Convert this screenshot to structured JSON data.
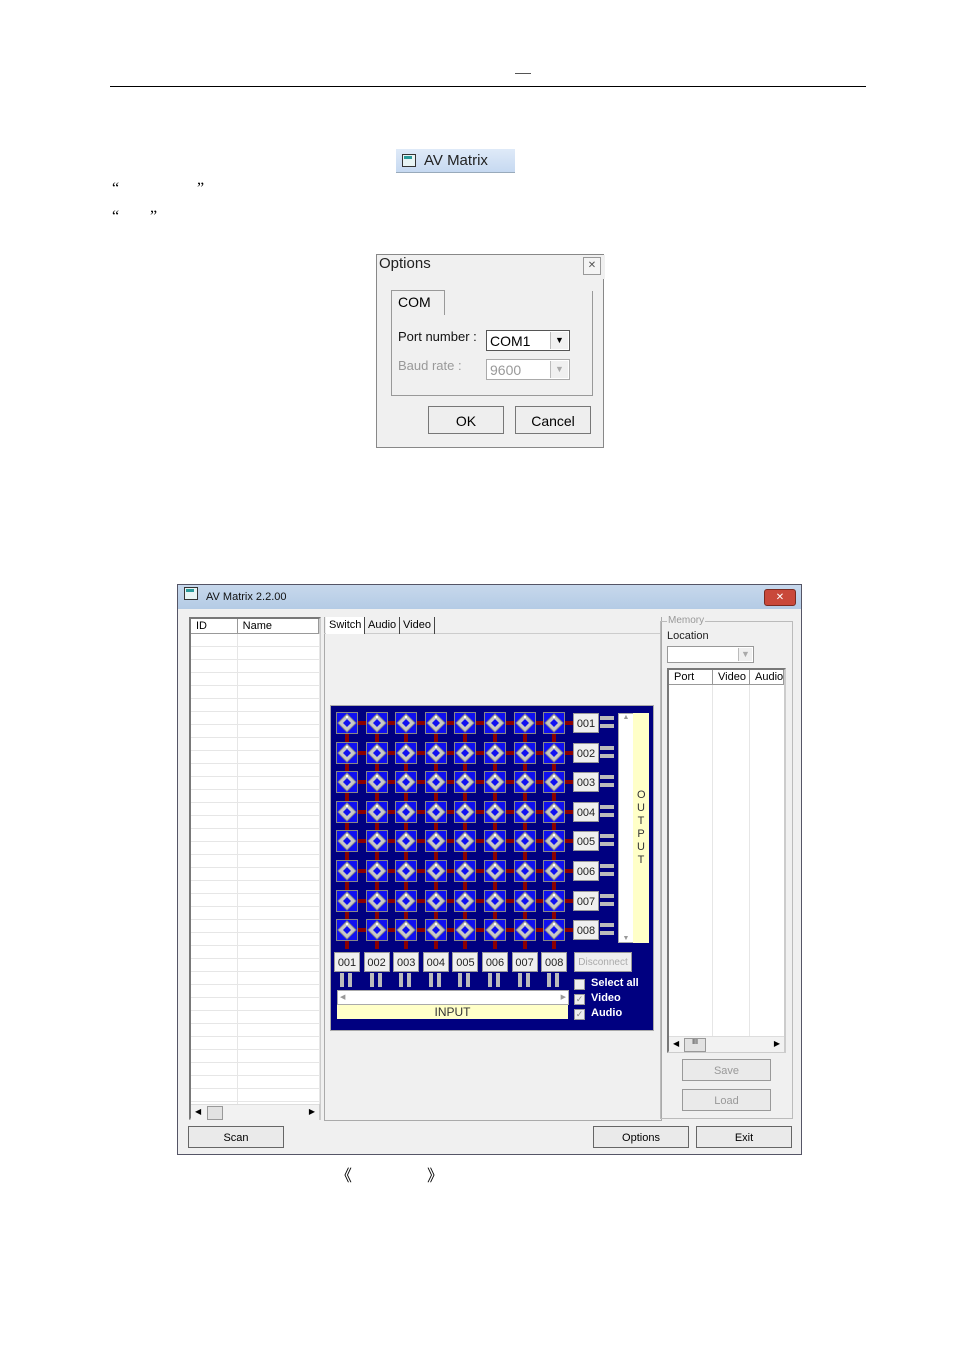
{
  "document": {
    "header_mark": "—",
    "quote_lines": [
      {
        "open": "“",
        "close": "”"
      },
      {
        "open": "“",
        "close": "”"
      }
    ],
    "caption_brackets": {
      "open": "《",
      "close": "》"
    }
  },
  "taskbar_button": {
    "label": "AV Matrix",
    "icon": "app-window-icon"
  },
  "options_dialog": {
    "title": "Options",
    "close_icon": "close-icon",
    "tab": "COM",
    "port_label": "Port number :",
    "port_value": "COM1",
    "baud_label": "Baud rate :",
    "baud_value": "9600",
    "ok_label": "OK",
    "cancel_label": "Cancel"
  },
  "app_window": {
    "title": "AV Matrix 2.2.00",
    "device_list": {
      "columns": [
        "ID",
        "Name"
      ],
      "rows": []
    },
    "tabs": [
      {
        "label": "Switch",
        "active": true
      },
      {
        "label": "Audio",
        "active": false
      },
      {
        "label": "Video",
        "active": false
      }
    ],
    "matrix": {
      "outputs": [
        "001",
        "002",
        "003",
        "004",
        "005",
        "006",
        "007",
        "008"
      ],
      "inputs": [
        "001",
        "002",
        "003",
        "004",
        "005",
        "006",
        "007",
        "008"
      ],
      "output_label": "OUTPUT",
      "input_label": "INPUT",
      "disconnect_label": "Disconnect",
      "select_all": {
        "label": "Select all",
        "checked": false
      },
      "video": {
        "label": "Video",
        "checked": true
      },
      "audio": {
        "label": "Audio",
        "checked": true
      }
    },
    "memory": {
      "group_label": "Memory",
      "location_label": "Location",
      "location_value": "",
      "columns": [
        "Port",
        "Video",
        "Audio"
      ],
      "save_label": "Save",
      "load_label": "Load"
    },
    "scan_label": "Scan",
    "options_label": "Options",
    "exit_label": "Exit",
    "colors": {
      "matrix_bg": "#000080",
      "cell_bg": "#1010f0",
      "link": "#8b0000",
      "label_bg": "#ffffc8"
    }
  }
}
